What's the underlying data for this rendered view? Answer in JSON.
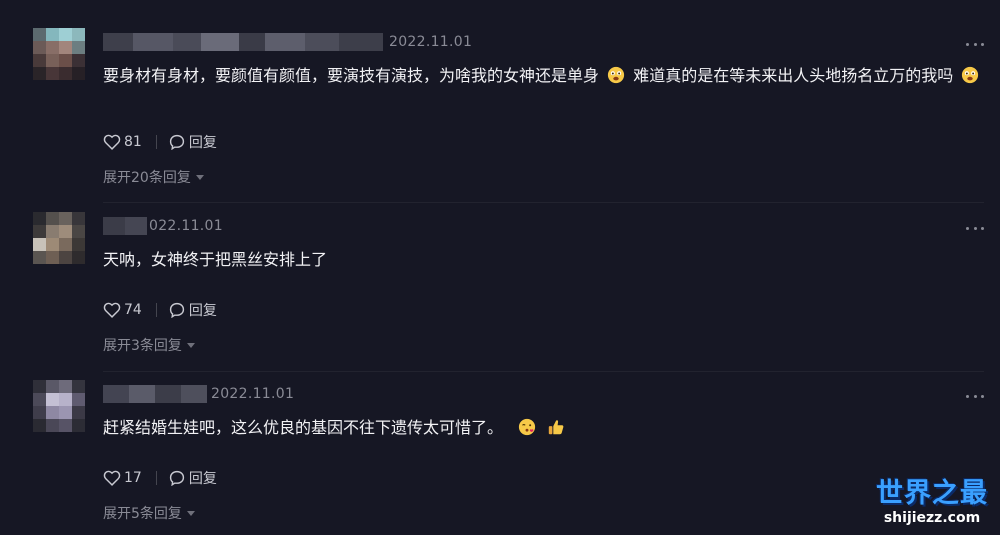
{
  "comments": [
    {
      "date": "2022.11.01",
      "text_part1": "要身材有身材，要颜值有颜值，要演技有演技，为啥我的女神还是单身",
      "text_part2": "难道真的是在等未来出人头地扬名立万的我吗",
      "emojis": [
        "drooling-face-icon",
        "drooling-face-icon"
      ],
      "likes": "81",
      "reply_label": "回复",
      "expand_label": "展开20条回复"
    },
    {
      "date": "022.11.01",
      "text_part1": "天呐，女神终于把黑丝安排上了",
      "likes": "74",
      "reply_label": "回复",
      "expand_label": "展开3条回复"
    },
    {
      "date": "2022.11.01",
      "text_part1": "赶紧结婚生娃吧，这么优良的基因不往下遗传太可惜了。",
      "emojis": [
        "blowing-kiss-icon",
        "thumbs-up-icon"
      ],
      "likes": "17",
      "reply_label": "回复",
      "expand_label": "展开5条回复"
    }
  ],
  "watermark": {
    "title": "世界之最",
    "url": "shijiezz.com"
  },
  "colors": {
    "background": "#161724",
    "text": "#f2f2f5",
    "muted": "#8a8b96"
  }
}
